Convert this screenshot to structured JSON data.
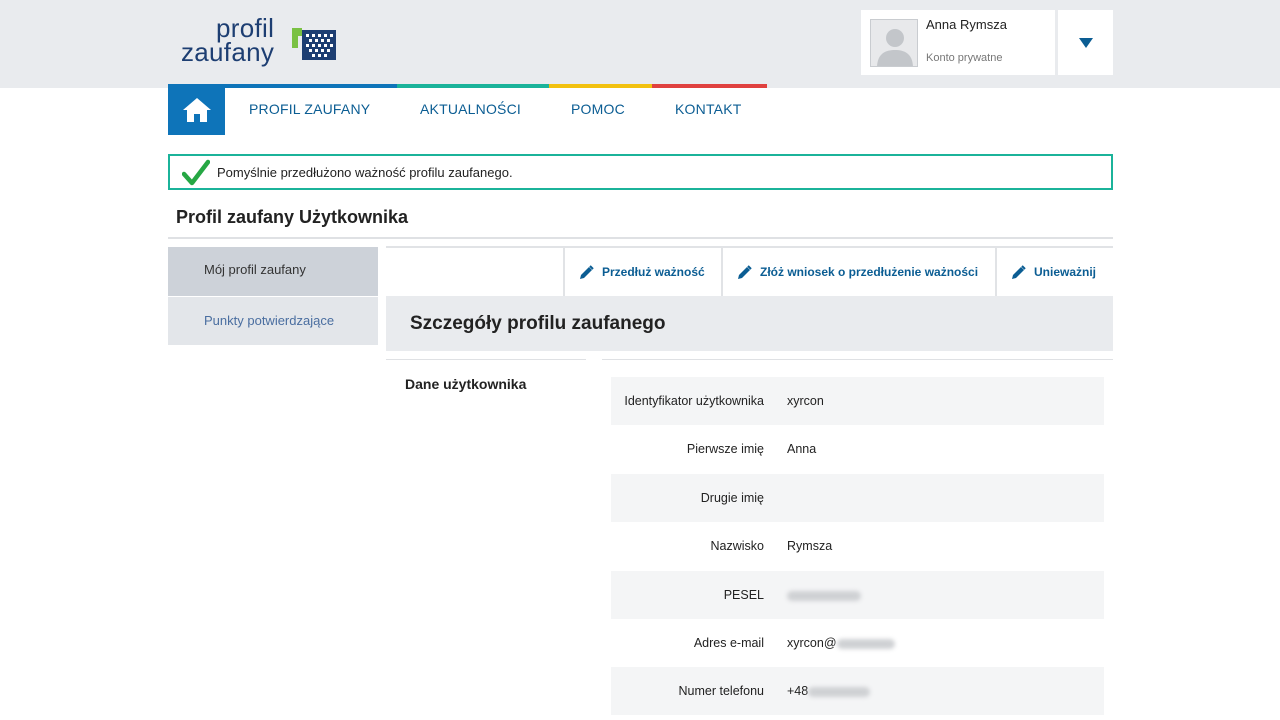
{
  "brand": {
    "logo_line1": "profil",
    "logo_line2": "zaufany"
  },
  "user": {
    "name": "Anna Rymsza",
    "account_type": "Konto prywatne"
  },
  "nav": {
    "items": [
      {
        "label": "PROFIL ZAUFANY"
      },
      {
        "label": "AKTUALNOŚCI"
      },
      {
        "label": "POMOC"
      },
      {
        "label": "KONTAKT"
      }
    ],
    "colors": [
      "#0e74b9",
      "#1bb39a",
      "#f2c10f",
      "#e0413f"
    ]
  },
  "alert": {
    "message": "Pomyślnie przedłużono ważność profilu zaufanego.",
    "color": "#1bb39a"
  },
  "page_title": "Profil zaufany Użytkownika",
  "sidebar": {
    "items": [
      {
        "label": "Mój profil zaufany",
        "active": true
      },
      {
        "label": "Punkty potwierdzające",
        "active": false
      }
    ]
  },
  "actions": [
    {
      "label": "Przedłuż ważność",
      "icon": "pencil-icon"
    },
    {
      "label": "Złóż wniosek o przedłużenie ważności",
      "icon": "pencil-icon"
    },
    {
      "label": "Unieważnij",
      "icon": "pencil-icon"
    }
  ],
  "panel": {
    "title": "Szczegóły profilu zaufanego",
    "section": "Dane użytkownika",
    "fields": [
      {
        "label": "Identyfikator użytkownika",
        "value": "xyrcon"
      },
      {
        "label": "Pierwsze imię",
        "value": "Anna"
      },
      {
        "label": "Drugie imię",
        "value": ""
      },
      {
        "label": "Nazwisko",
        "value": "Rymsza"
      },
      {
        "label": "PESEL",
        "value": ""
      },
      {
        "label": "Adres e-mail",
        "value": "xyrcon@"
      },
      {
        "label": "Numer telefonu",
        "value": "+48"
      }
    ]
  },
  "accent": "#0e74b9"
}
